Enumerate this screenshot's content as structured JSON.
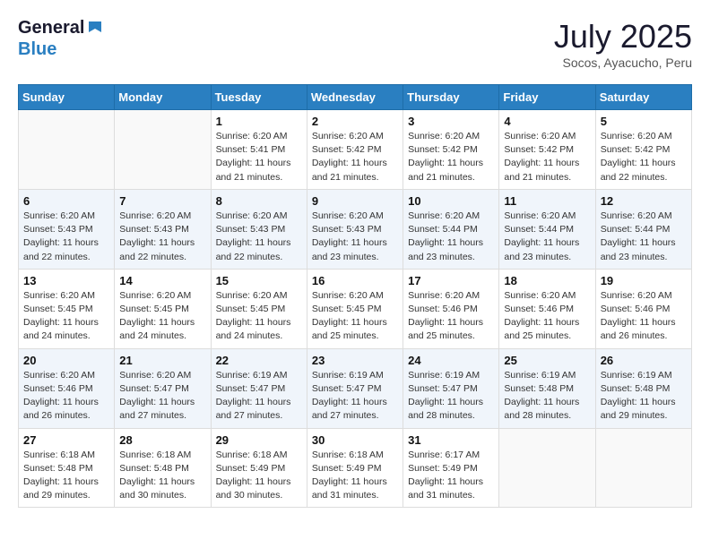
{
  "header": {
    "logo_general": "General",
    "logo_blue": "Blue",
    "month": "July 2025",
    "location": "Socos, Ayacucho, Peru"
  },
  "weekdays": [
    "Sunday",
    "Monday",
    "Tuesday",
    "Wednesday",
    "Thursday",
    "Friday",
    "Saturday"
  ],
  "weeks": [
    [
      {
        "day": "",
        "info": ""
      },
      {
        "day": "",
        "info": ""
      },
      {
        "day": "1",
        "info": "Sunrise: 6:20 AM\nSunset: 5:41 PM\nDaylight: 11 hours and 21 minutes."
      },
      {
        "day": "2",
        "info": "Sunrise: 6:20 AM\nSunset: 5:42 PM\nDaylight: 11 hours and 21 minutes."
      },
      {
        "day": "3",
        "info": "Sunrise: 6:20 AM\nSunset: 5:42 PM\nDaylight: 11 hours and 21 minutes."
      },
      {
        "day": "4",
        "info": "Sunrise: 6:20 AM\nSunset: 5:42 PM\nDaylight: 11 hours and 21 minutes."
      },
      {
        "day": "5",
        "info": "Sunrise: 6:20 AM\nSunset: 5:42 PM\nDaylight: 11 hours and 22 minutes."
      }
    ],
    [
      {
        "day": "6",
        "info": "Sunrise: 6:20 AM\nSunset: 5:43 PM\nDaylight: 11 hours and 22 minutes."
      },
      {
        "day": "7",
        "info": "Sunrise: 6:20 AM\nSunset: 5:43 PM\nDaylight: 11 hours and 22 minutes."
      },
      {
        "day": "8",
        "info": "Sunrise: 6:20 AM\nSunset: 5:43 PM\nDaylight: 11 hours and 22 minutes."
      },
      {
        "day": "9",
        "info": "Sunrise: 6:20 AM\nSunset: 5:43 PM\nDaylight: 11 hours and 23 minutes."
      },
      {
        "day": "10",
        "info": "Sunrise: 6:20 AM\nSunset: 5:44 PM\nDaylight: 11 hours and 23 minutes."
      },
      {
        "day": "11",
        "info": "Sunrise: 6:20 AM\nSunset: 5:44 PM\nDaylight: 11 hours and 23 minutes."
      },
      {
        "day": "12",
        "info": "Sunrise: 6:20 AM\nSunset: 5:44 PM\nDaylight: 11 hours and 23 minutes."
      }
    ],
    [
      {
        "day": "13",
        "info": "Sunrise: 6:20 AM\nSunset: 5:45 PM\nDaylight: 11 hours and 24 minutes."
      },
      {
        "day": "14",
        "info": "Sunrise: 6:20 AM\nSunset: 5:45 PM\nDaylight: 11 hours and 24 minutes."
      },
      {
        "day": "15",
        "info": "Sunrise: 6:20 AM\nSunset: 5:45 PM\nDaylight: 11 hours and 24 minutes."
      },
      {
        "day": "16",
        "info": "Sunrise: 6:20 AM\nSunset: 5:45 PM\nDaylight: 11 hours and 25 minutes."
      },
      {
        "day": "17",
        "info": "Sunrise: 6:20 AM\nSunset: 5:46 PM\nDaylight: 11 hours and 25 minutes."
      },
      {
        "day": "18",
        "info": "Sunrise: 6:20 AM\nSunset: 5:46 PM\nDaylight: 11 hours and 25 minutes."
      },
      {
        "day": "19",
        "info": "Sunrise: 6:20 AM\nSunset: 5:46 PM\nDaylight: 11 hours and 26 minutes."
      }
    ],
    [
      {
        "day": "20",
        "info": "Sunrise: 6:20 AM\nSunset: 5:46 PM\nDaylight: 11 hours and 26 minutes."
      },
      {
        "day": "21",
        "info": "Sunrise: 6:20 AM\nSunset: 5:47 PM\nDaylight: 11 hours and 27 minutes."
      },
      {
        "day": "22",
        "info": "Sunrise: 6:19 AM\nSunset: 5:47 PM\nDaylight: 11 hours and 27 minutes."
      },
      {
        "day": "23",
        "info": "Sunrise: 6:19 AM\nSunset: 5:47 PM\nDaylight: 11 hours and 27 minutes."
      },
      {
        "day": "24",
        "info": "Sunrise: 6:19 AM\nSunset: 5:47 PM\nDaylight: 11 hours and 28 minutes."
      },
      {
        "day": "25",
        "info": "Sunrise: 6:19 AM\nSunset: 5:48 PM\nDaylight: 11 hours and 28 minutes."
      },
      {
        "day": "26",
        "info": "Sunrise: 6:19 AM\nSunset: 5:48 PM\nDaylight: 11 hours and 29 minutes."
      }
    ],
    [
      {
        "day": "27",
        "info": "Sunrise: 6:18 AM\nSunset: 5:48 PM\nDaylight: 11 hours and 29 minutes."
      },
      {
        "day": "28",
        "info": "Sunrise: 6:18 AM\nSunset: 5:48 PM\nDaylight: 11 hours and 30 minutes."
      },
      {
        "day": "29",
        "info": "Sunrise: 6:18 AM\nSunset: 5:49 PM\nDaylight: 11 hours and 30 minutes."
      },
      {
        "day": "30",
        "info": "Sunrise: 6:18 AM\nSunset: 5:49 PM\nDaylight: 11 hours and 31 minutes."
      },
      {
        "day": "31",
        "info": "Sunrise: 6:17 AM\nSunset: 5:49 PM\nDaylight: 11 hours and 31 minutes."
      },
      {
        "day": "",
        "info": ""
      },
      {
        "day": "",
        "info": ""
      }
    ]
  ]
}
